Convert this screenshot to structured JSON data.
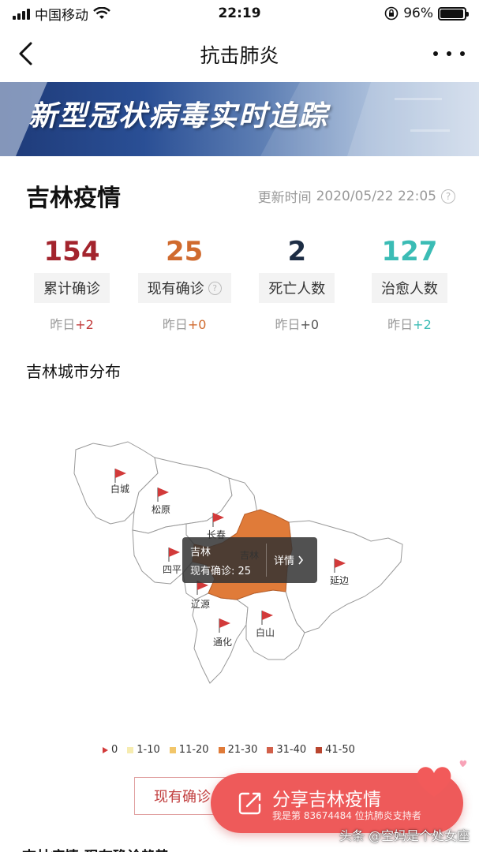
{
  "status_bar": {
    "carrier": "中国移动",
    "time": "22:19",
    "battery": "96%",
    "battery_level": 0.96
  },
  "nav": {
    "title": "抗击肺炎"
  },
  "banner": {
    "title": "新型冠状病毒实时追踪"
  },
  "section": {
    "title": "吉林疫情",
    "update_label": "更新时间",
    "update_time": "2020/05/22 22:05"
  },
  "stats": [
    {
      "value": "154",
      "label": "累计确诊",
      "yesterday_label": "昨日",
      "delta": "+2",
      "color": "#a3242d",
      "delta_color": "#c23a3a"
    },
    {
      "value": "25",
      "label": "现有确诊",
      "yesterday_label": "昨日",
      "delta": "+0",
      "color": "#d06a2e",
      "delta_color": "#d06a2e"
    },
    {
      "value": "2",
      "label": "死亡人数",
      "yesterday_label": "昨日",
      "delta": "+0",
      "color": "#1d2d44",
      "delta_color": "#555555"
    },
    {
      "value": "127",
      "label": "治愈人数",
      "yesterday_label": "昨日",
      "delta": "+2",
      "color": "#3bbcb5",
      "delta_color": "#3bbcb5"
    }
  ],
  "city_section": {
    "title": "吉林城市分布"
  },
  "map": {
    "cities": [
      "白城",
      "松原",
      "长春",
      "吉林",
      "四平",
      "辽源",
      "延边",
      "通化",
      "白山"
    ],
    "highlight": "吉林",
    "highlight_color": "#e07b39"
  },
  "tooltip": {
    "name": "吉林",
    "value_label": "现有确诊: 25",
    "detail": "详情"
  },
  "legend": [
    {
      "label": "0",
      "color": "#d23a3a"
    },
    {
      "label": "1-10",
      "color": "#f6ecb0"
    },
    {
      "label": "11-20",
      "color": "#f2c66a"
    },
    {
      "label": "21-30",
      "color": "#e07b39"
    },
    {
      "label": "31-40",
      "color": "#d2604a"
    },
    {
      "label": "41-50",
      "color": "#b9452f"
    }
  ],
  "bottom": {
    "tab_label": "现有确诊",
    "share_title": "分享吉林疫情",
    "share_sub": "我是第 83674484 位抗肺炎支持者",
    "next_section": "吉林疫情·现有确诊趋势"
  },
  "watermark": "头条 @空妈是个处女座"
}
